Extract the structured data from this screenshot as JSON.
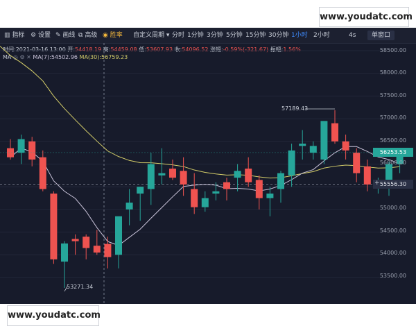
{
  "watermark_text": "www.youdatc.com",
  "toolbar": {
    "indicators": "指标",
    "settings": "设置",
    "draw": "画线",
    "advanced": "高级",
    "win_rate": "胜率",
    "custom_period": "自定义周期",
    "periods": [
      "分时",
      "1分钟",
      "3分钟",
      "5分钟",
      "15分钟",
      "30分钟",
      "1小时",
      "2小时"
    ],
    "active_period": "1小时",
    "refresh": "4s",
    "single_window": "单窗口"
  },
  "info": {
    "time_label": "时间:",
    "time": "2021-03-16 13:00",
    "open_label": "开:",
    "open": "54418.19",
    "high_label": "高:",
    "high": "54459.08",
    "low_label": "低:",
    "low": "53607.93",
    "close_label": "收:",
    "close": "54096.52",
    "change_label": "涨幅:",
    "change": "-0.59%(-321.67)",
    "amplitude_label": "振幅:",
    "amplitude": "1.56%"
  },
  "ma": {
    "label": "MA",
    "ma7": "MA(7):54502.96",
    "ma30": "MA(30):56759.23"
  },
  "price_labels": [
    "58500.00",
    "58000.00",
    "57500.00",
    "57000.00",
    "56500.00",
    "56000.00",
    "55500.00",
    "55000.00",
    "54500.00",
    "54000.00",
    "53500.00"
  ],
  "high_marker": "57189.43",
  "low_marker": "53271.34",
  "current_price": "56253.53",
  "crosshair_price": "55556.30",
  "colors": {
    "background": "#171b2b",
    "up": "#26a69a",
    "down": "#ef5350",
    "ma7": "#c9c3d9",
    "ma30": "#d6cf6a",
    "accent": "#3f8cff"
  },
  "chart_data": {
    "type": "candlestick",
    "interval": "1小时",
    "ylim": [
      53100,
      58700
    ],
    "candles": [
      {
        "open": 56350,
        "high": 56550,
        "low": 56100,
        "close": 56150
      },
      {
        "open": 56250,
        "high": 56650,
        "low": 56000,
        "close": 56550
      },
      {
        "open": 56500,
        "high": 56600,
        "low": 55950,
        "close": 56100
      },
      {
        "open": 56150,
        "high": 56300,
        "low": 55400,
        "close": 55450
      },
      {
        "open": 55350,
        "high": 55400,
        "low": 53800,
        "close": 53900
      },
      {
        "open": 53850,
        "high": 54300,
        "low": 53271.34,
        "close": 54250
      },
      {
        "open": 54350,
        "high": 54450,
        "low": 54000,
        "close": 54300
      },
      {
        "open": 54400,
        "high": 54450,
        "low": 53900,
        "close": 54150
      },
      {
        "open": 54200,
        "high": 54550,
        "low": 54000,
        "close": 54050
      },
      {
        "open": 54240,
        "high": 54400,
        "low": 53700,
        "close": 53950
      },
      {
        "open": 54000,
        "high": 54800,
        "low": 53700,
        "close": 54850
      },
      {
        "open": 55000,
        "high": 55450,
        "low": 54650,
        "close": 55150
      },
      {
        "open": 55350,
        "high": 55500,
        "low": 54750,
        "close": 55500
      },
      {
        "open": 55450,
        "high": 56250,
        "low": 55100,
        "close": 56000
      },
      {
        "open": 55750,
        "high": 56350,
        "low": 55550,
        "close": 55800
      },
      {
        "open": 55900,
        "high": 56100,
        "low": 55650,
        "close": 55700
      },
      {
        "open": 55850,
        "high": 56150,
        "low": 55300,
        "close": 55550
      },
      {
        "open": 55450,
        "high": 55800,
        "low": 54900,
        "close": 55050
      },
      {
        "open": 55050,
        "high": 55400,
        "low": 54950,
        "close": 55250
      },
      {
        "open": 55350,
        "high": 55600,
        "low": 55200,
        "close": 55400
      },
      {
        "open": 55600,
        "high": 55700,
        "low": 55200,
        "close": 55450
      },
      {
        "open": 55700,
        "high": 56000,
        "low": 55400,
        "close": 55850
      },
      {
        "open": 55900,
        "high": 56150,
        "low": 55500,
        "close": 55600
      },
      {
        "open": 55650,
        "high": 55750,
        "low": 55000,
        "close": 55250
      },
      {
        "open": 55250,
        "high": 55500,
        "low": 54850,
        "close": 55350
      },
      {
        "open": 55450,
        "high": 55850,
        "low": 55150,
        "close": 55800
      },
      {
        "open": 55750,
        "high": 56450,
        "low": 55500,
        "close": 56300
      },
      {
        "open": 56400,
        "high": 56750,
        "low": 56100,
        "close": 56450
      },
      {
        "open": 56250,
        "high": 56500,
        "low": 56100,
        "close": 56400
      },
      {
        "open": 56100,
        "high": 56800,
        "low": 56000,
        "close": 56950
      },
      {
        "open": 56900,
        "high": 57189.43,
        "low": 56450,
        "close": 56500
      },
      {
        "open": 56500,
        "high": 56650,
        "low": 56100,
        "close": 56300
      },
      {
        "open": 56250,
        "high": 56350,
        "low": 55600,
        "close": 55800
      },
      {
        "open": 55950,
        "high": 56100,
        "low": 55400,
        "close": 55550
      },
      {
        "open": 55550,
        "high": 55700,
        "low": 55350,
        "close": 55600
      },
      {
        "open": 55650,
        "high": 56050,
        "low": 55300,
        "close": 56000
      },
      {
        "open": 56000,
        "high": 56350,
        "low": 55800,
        "close": 56253.53
      }
    ]
  }
}
